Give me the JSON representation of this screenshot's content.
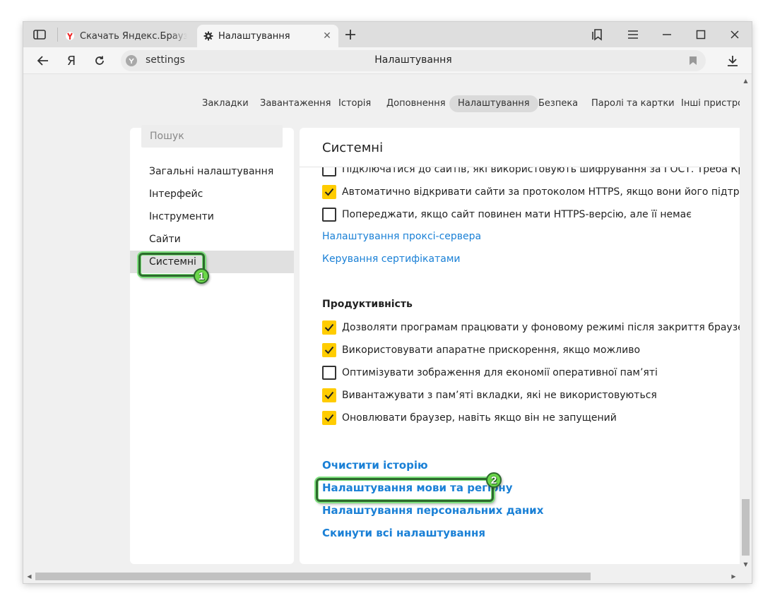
{
  "tabs": [
    {
      "title": "Скачать Яндекс.Браузер для",
      "icon": "yandex-browser-icon",
      "active": false
    },
    {
      "title": "Налаштування",
      "icon": "gear-icon",
      "active": true
    }
  ],
  "address_bar": {
    "url": "settings",
    "page_title": "Налаштування"
  },
  "top_nav": [
    "Закладки",
    "Завантаження",
    "Історія",
    "Доповнення",
    "Налаштування",
    "Безпека",
    "Паролі та картки",
    "Інші пристрої"
  ],
  "top_nav_active": "Налаштування",
  "search": {
    "placeholder": "Пошук"
  },
  "sidebar": {
    "items": [
      "Загальні налаштування",
      "Інтерфейс",
      "Інструменти",
      "Сайти",
      "Системні"
    ],
    "active": "Системні"
  },
  "section_title": "Системні",
  "network_options": [
    {
      "label": "Підключатися до сайтів, які використовують шифрування за ГОСТ. Треба КриптоПро",
      "checked": false
    },
    {
      "label": "Автоматично відкривати сайти за протоколом HTTPS, якщо вони його підтримують",
      "checked": true
    },
    {
      "label": "Попереджати, якщо сайт повинен мати HTTPS-версію, але її немає",
      "checked": false
    }
  ],
  "network_links": [
    "Налаштування проксі-сервера",
    "Керування сертифікатами"
  ],
  "performance": {
    "title": "Продуктивність",
    "options": [
      {
        "label": "Дозволяти програмам працювати у фоновому режимі після закриття браузера",
        "checked": true
      },
      {
        "label": "Використовувати апаратне прискорення, якщо можливо",
        "checked": true
      },
      {
        "label": "Оптимізувати зображення для економії оперативної пам’яті",
        "checked": false
      },
      {
        "label": "Вивантажувати з пам’яті вкладки, які не використовуються",
        "checked": true
      },
      {
        "label": "Оновлювати браузер, навіть якщо він не запущений",
        "checked": true
      }
    ]
  },
  "bottom_links": [
    "Очистити історію",
    "Налаштування мови та регіону",
    "Налаштування персональних даних",
    "Скинути всі налаштування"
  ],
  "annotations": [
    "1",
    "2"
  ],
  "colors": {
    "checkbox_on": "#ffcc00",
    "link": "#1a80d6",
    "annotation_green": "#6cd84a"
  }
}
